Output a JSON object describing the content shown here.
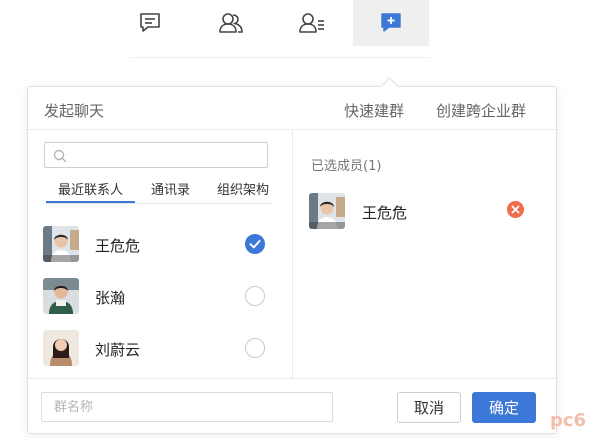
{
  "topnav": {
    "items": [
      {
        "icon": "message-icon",
        "active": false
      },
      {
        "icon": "contacts-icon",
        "active": false
      },
      {
        "icon": "org-list-icon",
        "active": false
      },
      {
        "icon": "add-chat-icon",
        "active": true
      }
    ]
  },
  "panel": {
    "title": "发起聊天",
    "quick_group": "快速建群",
    "cross_org_group": "创建跨企业群"
  },
  "search": {
    "placeholder": ""
  },
  "tabs": [
    {
      "label": "最近联系人",
      "active": true
    },
    {
      "label": "通讯录",
      "active": false
    },
    {
      "label": "组织架构",
      "active": false
    }
  ],
  "contacts": [
    {
      "name": "王危危",
      "checked": true
    },
    {
      "name": "张瀚",
      "checked": false
    },
    {
      "name": "刘蔚云",
      "checked": false
    }
  ],
  "selected": {
    "title": "已选成员(1)",
    "members": [
      {
        "name": "王危危"
      }
    ]
  },
  "footer": {
    "group_name_placeholder": "群名称",
    "cancel_label": "取消",
    "confirm_label": "确定"
  },
  "colors": {
    "accent": "#3b78d8",
    "remove": "#ef6c4d"
  }
}
